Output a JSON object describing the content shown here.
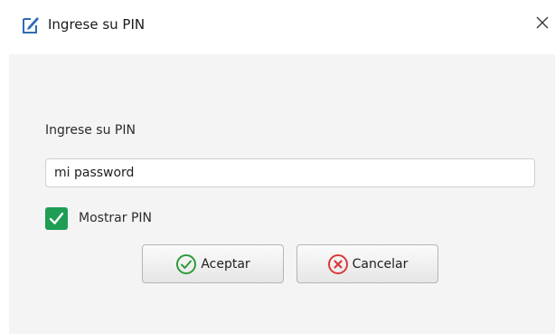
{
  "window": {
    "title": "Ingrese su PIN",
    "app_icon": "edit-document-icon",
    "close_icon": "close-icon"
  },
  "form": {
    "pin_label": "Ingrese su PIN",
    "pin_value": "mi password",
    "show_pin_label": "Mostrar PIN",
    "show_pin_checked": true
  },
  "buttons": {
    "accept_label": "Aceptar",
    "accept_icon": "check-circle-icon",
    "cancel_label": "Cancelar",
    "cancel_icon": "x-circle-icon"
  },
  "colors": {
    "checkbox": "#1f9d55",
    "accept_icon": "#2e9b3a",
    "cancel_icon": "#d83a3a",
    "content_bg": "#f4f4f4"
  }
}
